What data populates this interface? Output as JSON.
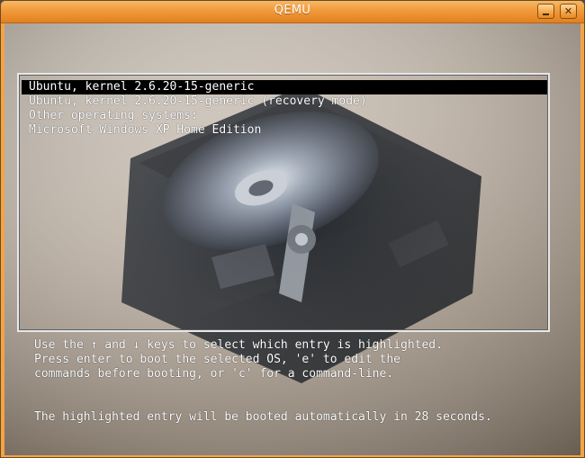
{
  "window": {
    "title": "QEMU",
    "minimize_label": "",
    "close_label": "✕"
  },
  "boot_menu": {
    "entries": [
      {
        "label": "Ubuntu, kernel 2.6.20-15-generic",
        "selected": true
      },
      {
        "label": "Ubuntu, kernel 2.6.20-15-generic (recovery mode)",
        "selected": false
      },
      {
        "label": "Other operating systems:",
        "selected": false
      },
      {
        "label": "Microsoft Windows XP Home Edition",
        "selected": false
      }
    ]
  },
  "help": {
    "line1": "Use the ↑ and ↓ keys to select which entry is highlighted.",
    "line2": "Press enter to boot the selected OS, 'e' to edit the",
    "line3": "commands before booting, or 'c' for a command-line."
  },
  "countdown": {
    "text": "The highlighted entry will be booted automatically in 28 seconds."
  },
  "colors": {
    "titlebar": "#f19a3b",
    "selection_bg": "#000000",
    "menu_text": "#ffffff"
  },
  "icons": {
    "minimize": "minimize-icon",
    "close": "close-icon",
    "background": "hard-drive-image"
  }
}
